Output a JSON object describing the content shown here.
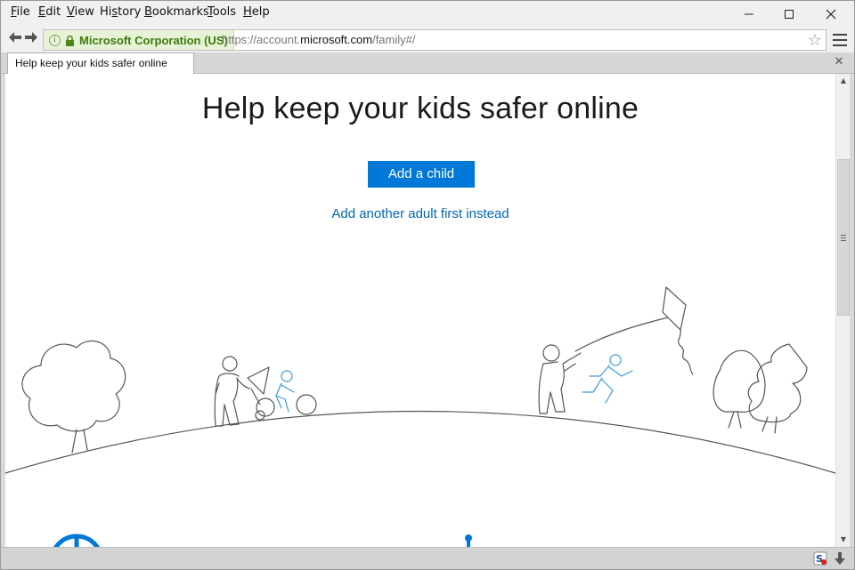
{
  "menubar": {
    "items": [
      {
        "label": "File",
        "accel": "F",
        "rest": "ile"
      },
      {
        "label": "Edit",
        "accel": "E",
        "rest": "dit"
      },
      {
        "label": "View",
        "accel": "V",
        "rest": "iew"
      },
      {
        "label": "History",
        "pre": "Hi",
        "accel": "s",
        "rest": "tory"
      },
      {
        "label": "Bookmarks",
        "accel": "B",
        "rest": "ookmarks"
      },
      {
        "label": "Tools",
        "accel": "T",
        "rest": "ools"
      },
      {
        "label": "Help",
        "accel": "H",
        "rest": "elp"
      }
    ],
    "window_controls": [
      "minimize-icon",
      "maximize-icon",
      "close-icon"
    ]
  },
  "navbar": {
    "identity_org": "Microsoft Corporation (US)",
    "url_prefix": "https://account.",
    "url_host": "microsoft.com",
    "url_path": "/family#/",
    "icons": [
      "back-arrow-icon",
      "forward-arrow-icon",
      "info-icon",
      "lock-icon",
      "bookmark-star-icon",
      "menu-icon"
    ]
  },
  "tabs": [
    {
      "title": "Help keep your kids safer online"
    }
  ],
  "page": {
    "heading": "Help keep your kids safer online",
    "primary_button": "Add a child",
    "secondary_link": "Add another adult first instead"
  },
  "colors": {
    "accent": "#0078d7",
    "link": "#0067b8",
    "identity_green": "#3d7a0e",
    "illustration_line": "#555555",
    "illustration_blue": "#3a9be0"
  }
}
